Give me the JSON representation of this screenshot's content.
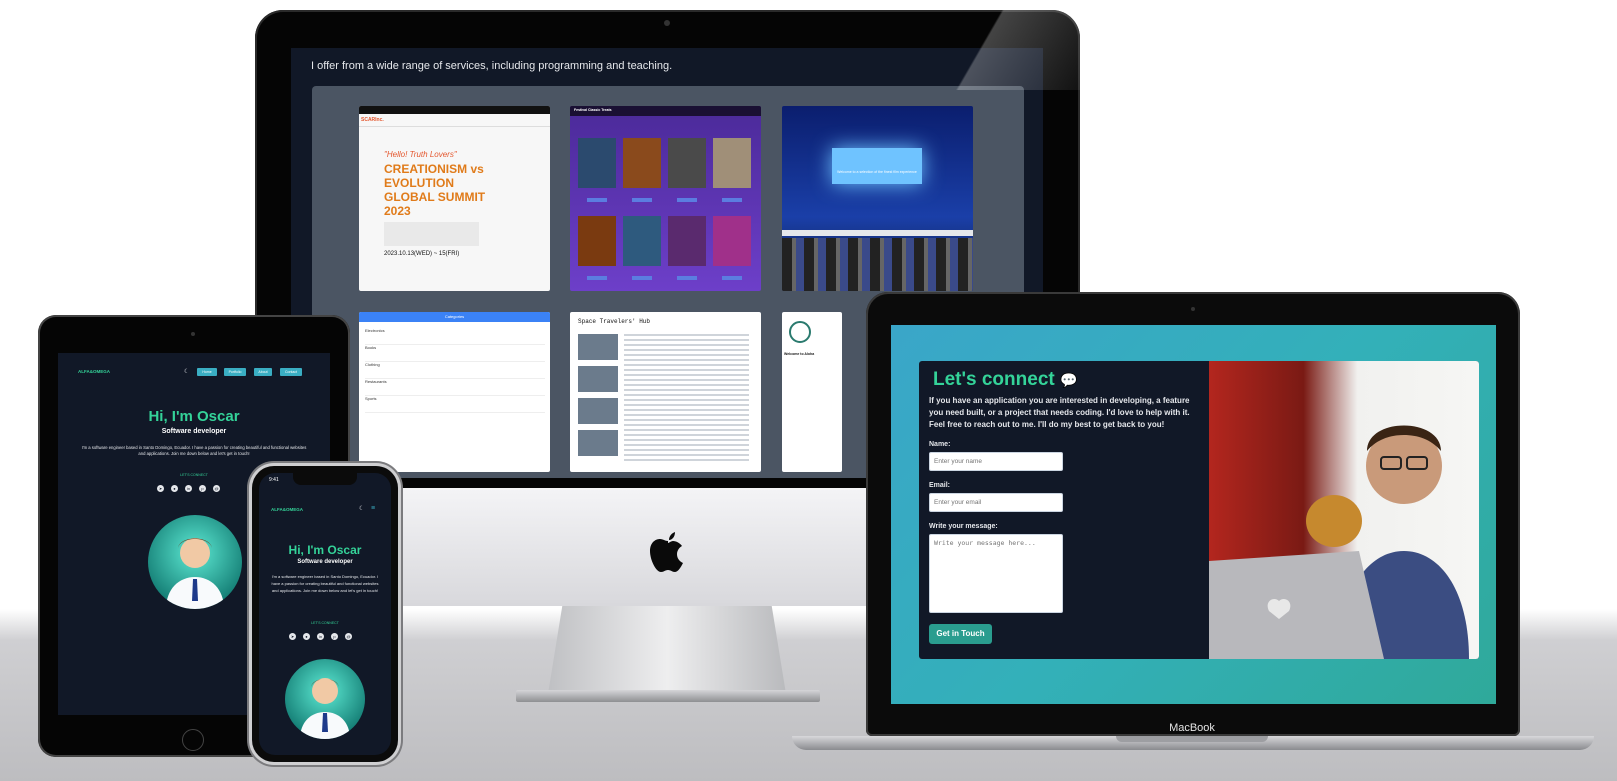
{
  "imac": {
    "header_text": "I offer from a wide range of services, including programming and teaching.",
    "projects": [
      {
        "title": "\"Hello! Truth Lovers\"",
        "headline": "CREATIONISM vs EVOLUTION GLOBAL SUMMIT 2023",
        "date": "2023.10.13(WED) ~ 15(FRI)",
        "brand": "SCARInc."
      },
      {
        "title": "Festival Classic Treats"
      },
      {
        "title": "Welcome to a selection of the finest film experience"
      },
      {
        "title": "Categories",
        "rows": [
          "Electronics",
          "Books",
          "Clothing",
          "Restaurants",
          "Sports"
        ]
      },
      {
        "title": "Space Travelers' Hub"
      },
      {
        "title": "Welcome to Aloha"
      }
    ]
  },
  "tablet": {
    "logo": "ALFA&OMEGA",
    "nav": [
      "Home",
      "Portfolio",
      "About",
      "Contact"
    ],
    "greeting": "Hi, I'm Oscar",
    "role": "Software developer",
    "bio": "I'm a software engineer based in Santo Domingo, Ecuador. I have a passion for creating beautiful and functional websites and applications. Join me down below and let's get in touch!",
    "cta": "LET'S CONNECT"
  },
  "phone": {
    "time": "9:41",
    "logo": "ALFA&OMEGA",
    "greeting": "Hi, I'm Oscar",
    "role": "Software developer",
    "bio": "I'm a software engineer based in Santo Domingo, Ecuador. I have a passion for creating beautiful and functional websites and applications. Join me down below and let's get in touch!",
    "cta": "LET'S CONNECT"
  },
  "macbook": {
    "brand": "MacBook",
    "heading": "Let's connect",
    "intro": "If you have an application you are interested in developing, a feature you need built, or a project that needs coding. I'd love to help with it. Feel free to reach out to me. I'll do my best to get back to you!",
    "name_label": "Name:",
    "name_placeholder": "Enter your name",
    "email_label": "Email:",
    "email_placeholder": "Enter your email",
    "message_label": "Write your message:",
    "message_placeholder": "Write your message here...",
    "submit": "Get in Touch"
  },
  "colors": {
    "accent": "#2a9d8f",
    "navy": "#111827",
    "teal_text": "#34d399"
  }
}
